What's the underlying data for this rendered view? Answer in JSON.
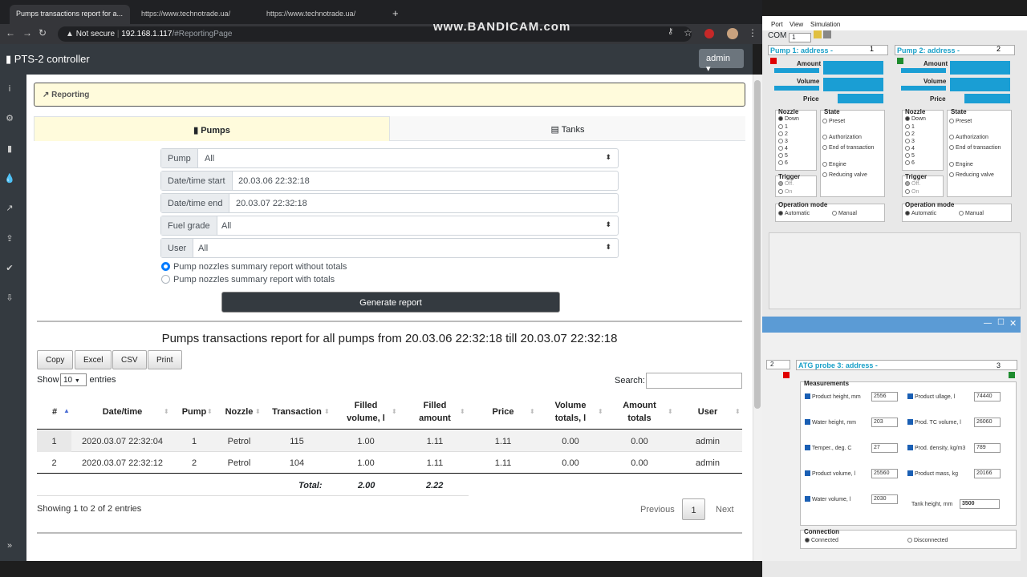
{
  "browser": {
    "tabs": [
      "Pumps transactions report for a...",
      "https://www.technotrade.ua/",
      "https://www.technotrade.ua/"
    ],
    "not_secure": "Not secure",
    "url_host": "192.168.1.117",
    "url_path": "/#ReportingPage"
  },
  "watermark": "www.BANDICAM.com",
  "app": {
    "title": "PTS-2 controller",
    "admin_label": "admin"
  },
  "reporting_header": "Reporting",
  "tabs": {
    "pumps": "Pumps",
    "tanks": "Tanks"
  },
  "form": {
    "pump_label": "Pump",
    "pump_value": "All",
    "start_label": "Date/time start",
    "start_value": "20.03.06 22:32:18",
    "end_label": "Date/time end",
    "end_value": "20.03.07 22:32:18",
    "fuel_label": "Fuel grade",
    "fuel_value": "All",
    "user_label": "User",
    "user_value": "All",
    "radio1": "Pump nozzles summary report without totals",
    "radio2": "Pump nozzles summary report with totals",
    "generate": "Generate report"
  },
  "report": {
    "title": "Pumps transactions report for all pumps from 20.03.06 22:32:18 till 20.03.07 22:32:18",
    "buttons": [
      "Copy",
      "Excel",
      "CSV",
      "Print"
    ],
    "show": "Show",
    "entries_value": "10",
    "entries": "entries",
    "search": "Search:",
    "columns": [
      "#",
      "Date/time",
      "Pump",
      "Nozzle",
      "Transaction",
      "Filled volume, l",
      "Filled amount",
      "Price",
      "Volume totals, l",
      "Amount totals",
      "User"
    ],
    "rows": [
      [
        "1",
        "2020.03.07 22:32:04",
        "1",
        "Petrol",
        "115",
        "1.00",
        "1.11",
        "1.11",
        "0.00",
        "0.00",
        "admin"
      ],
      [
        "2",
        "2020.03.07 22:32:12",
        "2",
        "Petrol",
        "104",
        "1.00",
        "1.11",
        "1.11",
        "0.00",
        "0.00",
        "admin"
      ]
    ],
    "total_label": "Total:",
    "total_volume": "2.00",
    "total_amount": "2.22",
    "info": "Showing 1 to 2 of 2 entries",
    "previous": "Previous",
    "page": "1",
    "next": "Next"
  },
  "sim": {
    "menu": [
      "Port",
      "View",
      "Simulation"
    ],
    "com_label": "COM",
    "com_value": "1",
    "pump1_title": "Pump 1: address -",
    "pump1_addr": "1",
    "pump2_title": "Pump 2: address -",
    "pump2_addr": "2",
    "amount": "Amount",
    "volume": "Volume",
    "price": "Price",
    "nozzle": "Nozzle",
    "state": "State",
    "nozzle_opts": [
      "Down",
      "1",
      "2",
      "3",
      "4",
      "5",
      "6"
    ],
    "state_opts": [
      "Preset",
      "Authorization",
      "End of transaction",
      "Engine",
      "Reducing valve"
    ],
    "trigger": "Trigger",
    "trigger_opts": [
      "Off.",
      "On"
    ],
    "opmode": "Operation mode",
    "opmode_opts": [
      "Automatic",
      "Manual"
    ],
    "atg_title": "ATG probe 3: address -",
    "atg_addr": "3",
    "left_addr": "2",
    "measurements": "Measurements",
    "meas": [
      {
        "label": "Product height, mm",
        "value": "2556"
      },
      {
        "label": "Product ullage, l",
        "value": "74440"
      },
      {
        "label": "Water height, mm",
        "value": "203"
      },
      {
        "label": "Prod. TC volume, l",
        "value": "26060"
      },
      {
        "label": "Temper., deg. C",
        "value": "27"
      },
      {
        "label": "Prod. density, kg/m3",
        "value": "789"
      },
      {
        "label": "Product volume, l",
        "value": "25560"
      },
      {
        "label": "Product mass, kg",
        "value": "20166"
      },
      {
        "label": "Water volume, l",
        "value": "2030"
      },
      {
        "label": "Tank height, mm",
        "value": "3500"
      }
    ],
    "connection": "Connection",
    "connected": "Connected",
    "disconnected": "Disconnected"
  },
  "colors": {
    "accent": "#007bff",
    "dark": "#343a40",
    "sim_blue": "#1a9ed4"
  }
}
